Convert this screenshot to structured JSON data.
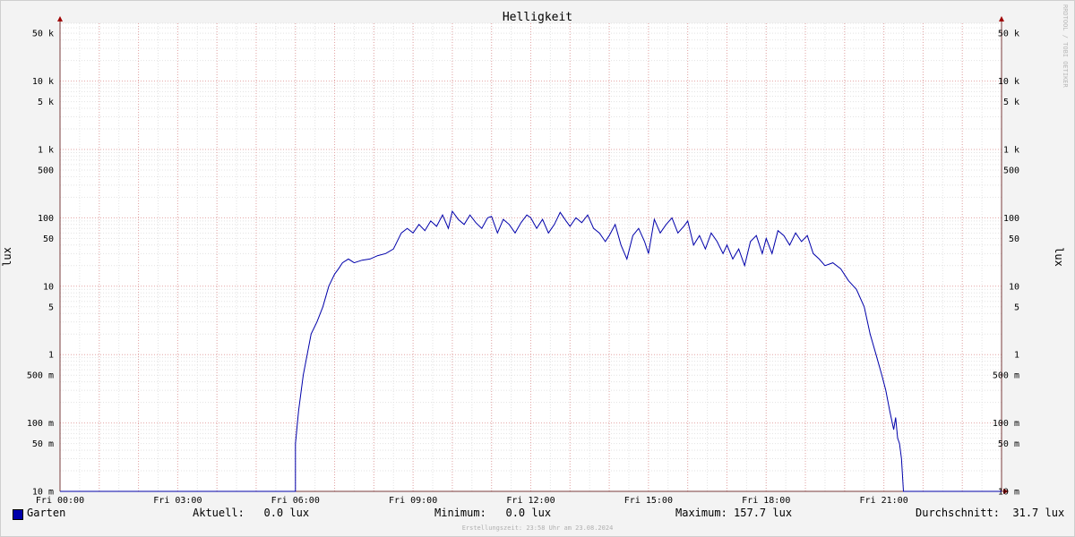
{
  "chart_data": {
    "type": "line",
    "title": "Helligkeit",
    "ylabel_left": "lux",
    "ylabel_right": "lux",
    "yscale": "log",
    "ylim": [
      0.01,
      70000
    ],
    "y_ticks": [
      {
        "v": 50000,
        "label": "50 k"
      },
      {
        "v": 10000,
        "label": "10 k"
      },
      {
        "v": 5000,
        "label": "5 k"
      },
      {
        "v": 1000,
        "label": "1 k"
      },
      {
        "v": 500,
        "label": "500"
      },
      {
        "v": 100,
        "label": "100"
      },
      {
        "v": 50,
        "label": "50"
      },
      {
        "v": 10,
        "label": "10"
      },
      {
        "v": 5,
        "label": "5"
      },
      {
        "v": 1,
        "label": "1"
      },
      {
        "v": 0.5,
        "label": "500 m"
      },
      {
        "v": 0.1,
        "label": "100 m"
      },
      {
        "v": 0.05,
        "label": "50 m"
      },
      {
        "v": 0.01,
        "label": "10 m"
      }
    ],
    "xlim": [
      0,
      24
    ],
    "x_ticks": [
      {
        "v": 0,
        "label": "Fri 00:00"
      },
      {
        "v": 3,
        "label": "Fri 03:00"
      },
      {
        "v": 6,
        "label": "Fri 06:00"
      },
      {
        "v": 9,
        "label": "Fri 09:00"
      },
      {
        "v": 12,
        "label": "Fri 12:00"
      },
      {
        "v": 15,
        "label": "Fri 15:00"
      },
      {
        "v": 18,
        "label": "Fri 18:00"
      },
      {
        "v": 21,
        "label": "Fri 21:00"
      }
    ],
    "grid": true,
    "series": [
      {
        "name": "Garten",
        "color": "#0000aa",
        "x": [
          0,
          6.0,
          6.0,
          6.08,
          6.15,
          6.2,
          6.3,
          6.4,
          6.55,
          6.7,
          6.85,
          7.0,
          7.1,
          7.2,
          7.35,
          7.5,
          7.7,
          7.9,
          8.1,
          8.3,
          8.5,
          8.7,
          8.85,
          9.0,
          9.15,
          9.3,
          9.45,
          9.6,
          9.75,
          9.9,
          10.0,
          10.15,
          10.3,
          10.45,
          10.6,
          10.75,
          10.9,
          11.0,
          11.15,
          11.3,
          11.45,
          11.6,
          11.75,
          11.9,
          12.0,
          12.15,
          12.3,
          12.45,
          12.6,
          12.75,
          12.9,
          13.0,
          13.15,
          13.3,
          13.45,
          13.6,
          13.75,
          13.9,
          14.0,
          14.15,
          14.3,
          14.45,
          14.6,
          14.75,
          14.9,
          15.0,
          15.15,
          15.3,
          15.45,
          15.6,
          15.75,
          15.9,
          16.0,
          16.15,
          16.3,
          16.45,
          16.6,
          16.75,
          16.9,
          17.0,
          17.15,
          17.3,
          17.45,
          17.6,
          17.75,
          17.9,
          18.0,
          18.15,
          18.3,
          18.45,
          18.6,
          18.75,
          18.9,
          19.05,
          19.2,
          19.35,
          19.5,
          19.7,
          19.9,
          20.1,
          20.3,
          20.5,
          20.65,
          20.8,
          20.95,
          21.05,
          21.15,
          21.25,
          21.3,
          21.35,
          21.4,
          21.45,
          21.5,
          21.5,
          24
        ],
        "values": [
          0.01,
          0.01,
          0.05,
          0.15,
          0.3,
          0.5,
          1.0,
          2.0,
          3.0,
          5.0,
          10,
          15,
          18,
          22,
          25,
          22,
          24,
          25,
          28,
          30,
          35,
          60,
          70,
          60,
          80,
          65,
          90,
          75,
          110,
          70,
          125,
          95,
          80,
          110,
          85,
          70,
          100,
          105,
          60,
          95,
          80,
          60,
          85,
          110,
          100,
          70,
          95,
          60,
          80,
          120,
          90,
          75,
          100,
          85,
          110,
          70,
          60,
          45,
          55,
          80,
          40,
          25,
          55,
          70,
          45,
          30,
          95,
          60,
          80,
          100,
          60,
          75,
          90,
          40,
          55,
          35,
          60,
          45,
          30,
          40,
          25,
          35,
          20,
          45,
          55,
          30,
          50,
          30,
          65,
          55,
          40,
          60,
          45,
          55,
          30,
          25,
          20,
          22,
          18,
          12,
          9,
          5,
          2.0,
          1.0,
          0.5,
          0.3,
          0.15,
          0.08,
          0.12,
          0.06,
          0.05,
          0.03,
          0.01,
          0.01,
          0.01
        ]
      }
    ]
  },
  "legend": {
    "series_name": "Garten",
    "aktuell": "Aktuell:   0.0 lux",
    "minimum": "Minimum:   0.0 lux",
    "maximum": "Maximum: 157.7 lux",
    "durchschnitt": "Durchschnitt:  31.7 lux"
  },
  "watermark": "RRDTOOL / TOBI OETIKER",
  "footer": "Erstellungszeit: 23:58 Uhr am 23.08.2024"
}
